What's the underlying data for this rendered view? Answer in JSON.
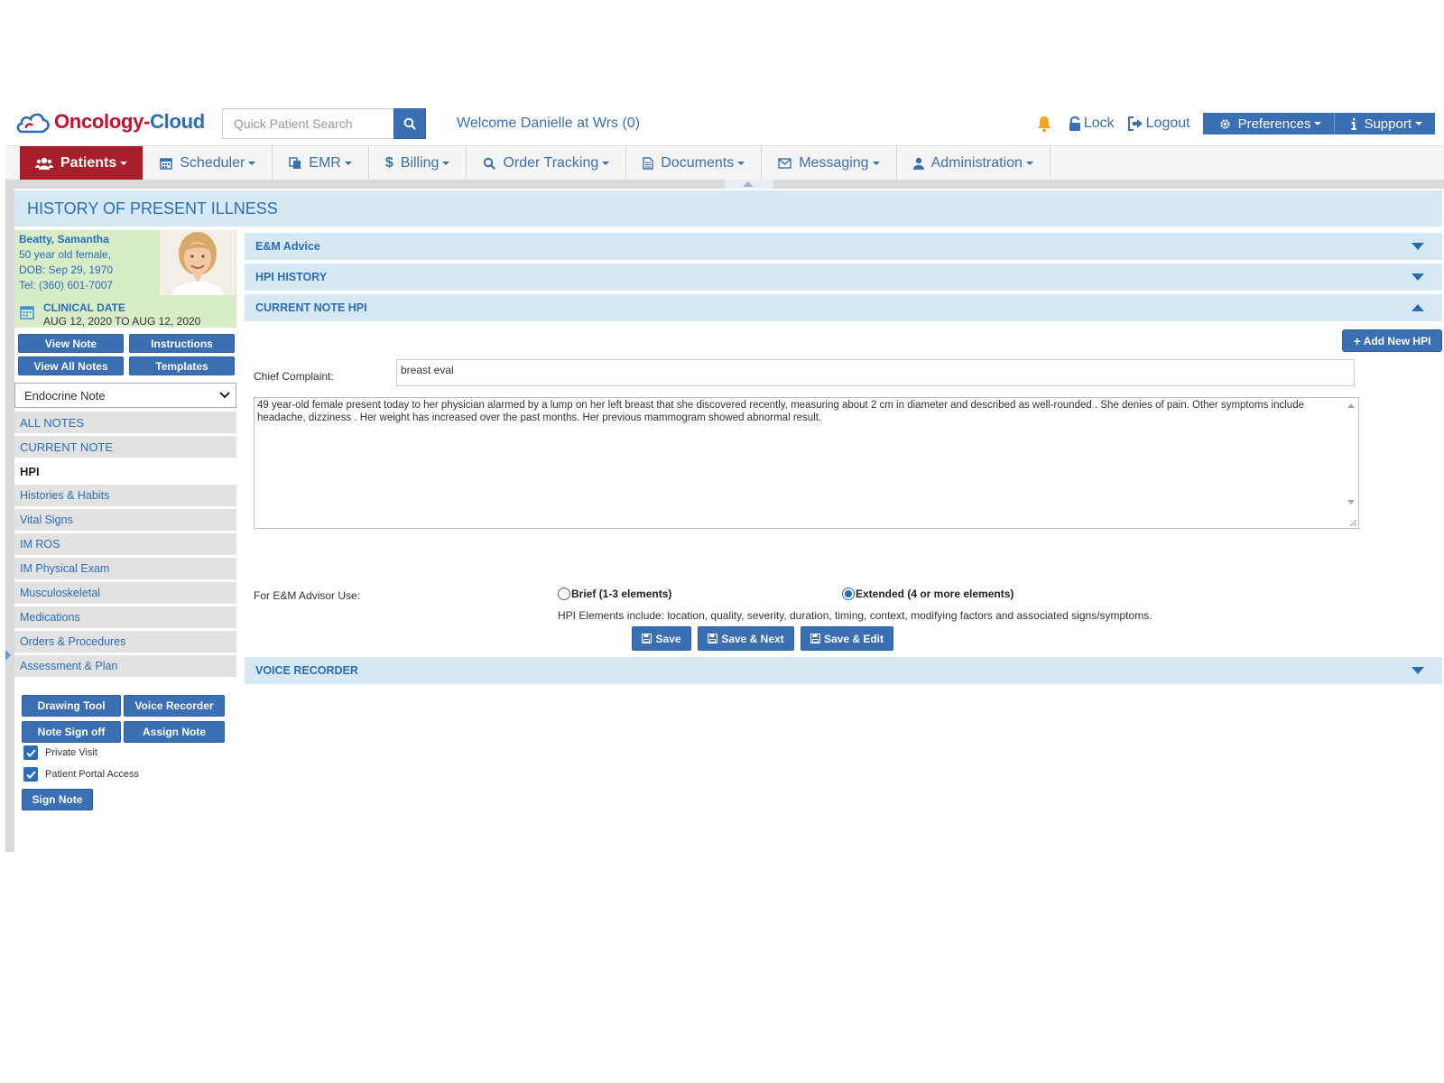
{
  "brand": {
    "part1": "Oncology-",
    "part2": "Cloud"
  },
  "search": {
    "placeholder": "Quick Patient Search"
  },
  "welcome": "Welcome Danielle at Wrs (0)",
  "header_links": {
    "lock": "Lock",
    "logout": "Logout",
    "preferences": "Preferences",
    "support": "Support"
  },
  "nav": [
    {
      "label": "Patients",
      "icon": "users-icon",
      "active": true
    },
    {
      "label": "Scheduler",
      "icon": "calendar-icon"
    },
    {
      "label": "EMR",
      "icon": "copy-icon"
    },
    {
      "label": "Billing",
      "icon": "dollar-icon"
    },
    {
      "label": "Order Tracking",
      "icon": "search-icon"
    },
    {
      "label": "Documents",
      "icon": "document-icon"
    },
    {
      "label": "Messaging",
      "icon": "envelope-icon"
    },
    {
      "label": "Administration",
      "icon": "user-icon"
    }
  ],
  "page_title": "HISTORY OF PRESENT ILLNESS",
  "patient": {
    "name": "Beatty, Samantha",
    "age_sex": "50 year old female,",
    "dob": "DOB: Sep 29, 1970",
    "tel": "Tel: (360) 601-7007",
    "clinical_label": "CLINICAL DATE",
    "clinical_value": "AUG 12, 2020 TO AUG 12, 2020"
  },
  "sidebar_buttons": {
    "view_note": "View Note",
    "instructions": "Instructions",
    "view_all": "View All Notes",
    "templates": "Templates"
  },
  "note_type": "Endocrine Note",
  "menu": [
    "ALL NOTES",
    "CURRENT NOTE",
    "HPI",
    "Histories & Habits",
    "Vital Signs",
    "IM ROS",
    "IM Physical Exam",
    "Musculoskeletal",
    "Medications",
    "Orders & Procedures",
    "Assessment & Plan"
  ],
  "tools": {
    "drawing": "Drawing Tool",
    "voice": "Voice Recorder",
    "signoff": "Note Sign off",
    "assign": "Assign Note"
  },
  "checks": {
    "private": "Private Visit",
    "portal": "Patient Portal Access"
  },
  "sign_note": "Sign Note",
  "sections": {
    "em_advice": "E&M Advice",
    "hpi_history": "HPI HISTORY",
    "current_note": "CURRENT NOTE HPI",
    "voice_recorder": "VOICE RECORDER"
  },
  "add_hpi": "Add New HPI",
  "chief_complaint": {
    "label": "Chief Complaint:",
    "value": "breast eval"
  },
  "hpi_text": "49 year-old  female present today to her physician alarmed by a lump on her left breast that she discovered recently, measuring about 2 cm in diameter and described as well-rounded . She denies of pain. Other symptoms include headache, dizziness . Her weight has increased over the past months. Her previous mammogram showed abnormal result.",
  "em_advisor": {
    "label": "For E&M Advisor Use:",
    "brief": "Brief (1-3 elements)",
    "extended": "Extended (4 or more elements)",
    "selected": "extended",
    "note": "HPI Elements include: location, quality, severity, duration, timing, context, modifying factors and associated signs/symptoms."
  },
  "actions": {
    "save": "Save",
    "save_next": "Save & Next",
    "save_edit": "Save & Edit"
  },
  "colors": {
    "brand_red": "#c8102e",
    "brand_blue": "#2a6db5",
    "primary": "#3a6fb3",
    "active_nav": "#a81e2a",
    "panel": "#d7e8f5",
    "patient_card": "#d8ecc8",
    "bell": "#f5a623"
  }
}
